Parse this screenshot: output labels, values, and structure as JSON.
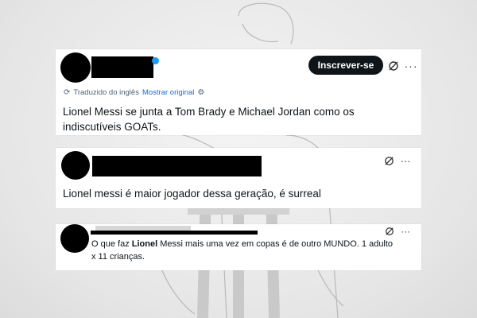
{
  "posts": [
    {
      "translated_note": "Traduzido do inglês",
      "show_original": "Mostrar original",
      "subscribe_label": "Inscrever-se",
      "body_lines": [
        "Lionel Messi se junta a Tom Brady e Michael Jordan como os",
        "indiscutíveis GOATs."
      ]
    },
    {
      "body_lines": [
        "Lionel messi é maior jogador dessa geração, é surreal"
      ]
    },
    {
      "body_lines": [
        {
          "before": "O que faz ",
          "bold": "Lionel",
          "after": " Messi mais uma vez em copas é de outro MUNDO. 1 adulto"
        },
        "x 11 crianças."
      ]
    }
  ],
  "icons": {
    "grok": "grok-icon",
    "more": "more-options-icon",
    "settings": "gear-icon",
    "translate": "translate-icon",
    "verified": "verified-badge-icon"
  },
  "colors": {
    "subscribe_bg": "#0f1419",
    "link": "#1d6bd1",
    "verified": "#1d9bf0"
  }
}
